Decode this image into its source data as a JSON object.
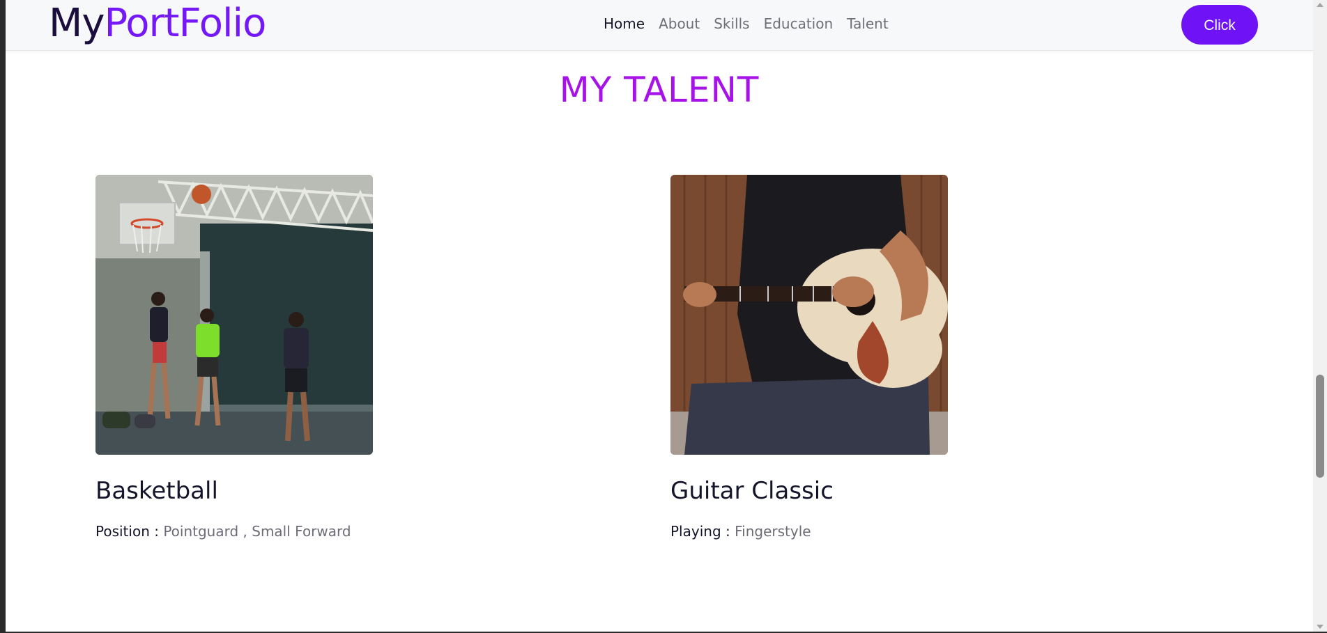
{
  "header": {
    "brand_part1": "My",
    "brand_part2": "PortFolio",
    "nav": [
      "Home",
      "About",
      "Skills",
      "Education",
      "Talent"
    ],
    "active_nav": "Home",
    "cta_label": "Click"
  },
  "talent": {
    "title": "MY TALENT",
    "items": [
      {
        "name": "Basketball",
        "detail_label": "Position :",
        "detail_value": "Pointguard , Small Forward",
        "image": "basketball-photo"
      },
      {
        "name": "Guitar Classic",
        "detail_label": "Playing :",
        "detail_value": "Fingerstyle",
        "image": "guitar-photo"
      }
    ]
  },
  "colors": {
    "brand_dark": "#1b0d3d",
    "brand_accent": "#7418f7",
    "section_title": "#a612e8",
    "cta_bg": "#6f12f5"
  }
}
